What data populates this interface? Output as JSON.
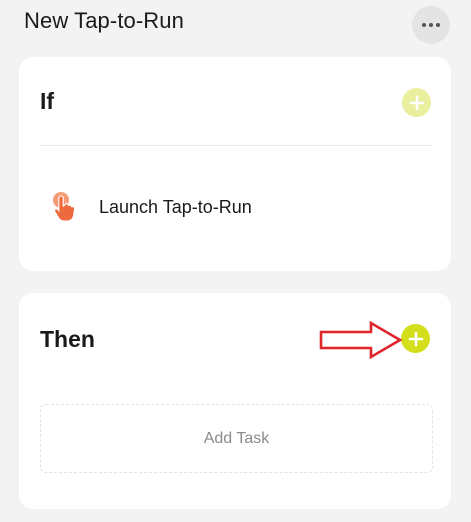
{
  "header": {
    "title": "New Tap-to-Run",
    "more_icon": "more-horizontal-icon"
  },
  "if_section": {
    "heading": "If",
    "add_icon": "plus-circle-icon",
    "add_state": "disabled",
    "conditions": [
      {
        "icon": "tap-hand-icon",
        "label": "Launch Tap-to-Run"
      }
    ]
  },
  "then_section": {
    "heading": "Then",
    "add_icon": "plus-circle-icon",
    "add_state": "enabled",
    "add_task_label": "Add Task"
  },
  "annotation": {
    "icon": "red-arrow-right-icon",
    "points_to": "then-add-button"
  },
  "colors": {
    "background": "#f3f3f3",
    "card": "#ffffff",
    "accent": "#d4df1c",
    "accent_disabled": "#e9ef9e",
    "tap_icon": "#f07a4f",
    "annotation_arrow": "#e0262b",
    "muted_text": "#8a8a8a"
  }
}
